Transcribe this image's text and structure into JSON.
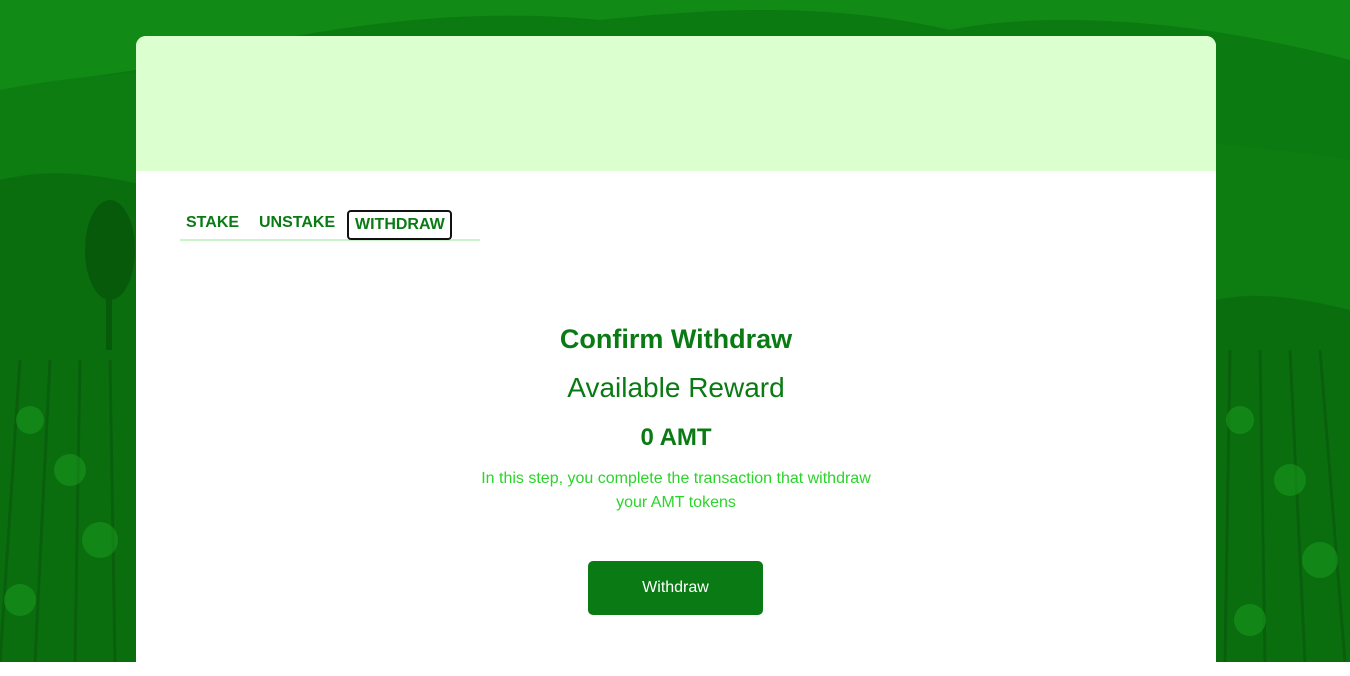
{
  "tabs": [
    {
      "label": "STAKE"
    },
    {
      "label": "UNSTAKE"
    },
    {
      "label": "WITHDRAW",
      "active": true
    }
  ],
  "withdraw": {
    "title": "Confirm Withdraw",
    "reward_label": "Available Reward",
    "reward_value": "0 AMT",
    "description": "In this step, you complete the transaction that withdraw your AMT tokens",
    "button_label": "Withdraw"
  },
  "colors": {
    "brand_green": "#0a7a14",
    "header_bg": "#dcffd0",
    "description_green": "#2bd42b",
    "background_green": "#0a7a0f"
  }
}
